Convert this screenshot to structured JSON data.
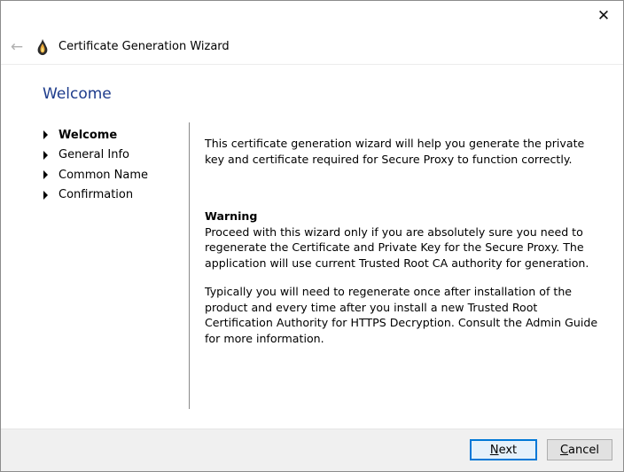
{
  "window": {
    "title": "Certificate Generation Wizard",
    "close_glyph": "✕",
    "back_glyph": "←"
  },
  "page": {
    "heading": "Welcome"
  },
  "steps": [
    {
      "label": "Welcome",
      "active": true
    },
    {
      "label": "General Info",
      "active": false
    },
    {
      "label": "Common Name",
      "active": false
    },
    {
      "label": "Confirmation",
      "active": false
    }
  ],
  "content": {
    "intro": "This certificate generation wizard will help you generate the private key and certificate required for Secure Proxy to function correctly.",
    "warning_title": "Warning",
    "warning_text": "Proceed with this wizard only if you are absolutely sure you need to regenerate the Certificate and Private Key for the Secure Proxy. The application will use current Trusted Root CA authority for generation.",
    "note": "Typically you will need to regenerate once after installation of the product and every time after you install a new Trusted Root Certification Authority for HTTPS Decryption. Consult the Admin Guide for more information."
  },
  "buttons": {
    "next_mnemonic": "N",
    "next_rest": "ext",
    "cancel_mnemonic": "C",
    "cancel_rest": "ancel"
  },
  "colors": {
    "heading": "#1e3c8c",
    "primary_border": "#0078d7"
  }
}
